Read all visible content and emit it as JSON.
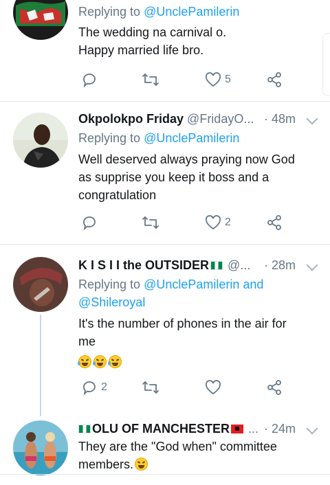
{
  "tweets": [
    {
      "name": "",
      "handle": "",
      "time": "",
      "replying_prefix": "Replying to",
      "replying_line1": "@UnclePamilerin",
      "replying_line2": "",
      "text_lines": [
        "The wedding na carnival o.",
        "Happy married life bro."
      ],
      "reply_count": "",
      "like_count": "5"
    },
    {
      "name": "Okpolokpo Friday",
      "handle": "@FridayO...",
      "time": "· 48m",
      "replying_prefix": "Replying to",
      "replying_line1": "@UnclePamilerin",
      "replying_line2": "",
      "text_lines": [
        "Well deserved always praying now God",
        "as supprise you keep it boss and a",
        "congratulation"
      ],
      "reply_count": "",
      "like_count": "2"
    },
    {
      "name": "K I S I I the OUTSIDER",
      "handle": "@...",
      "time": "· 28m",
      "replying_prefix": "Replying to",
      "replying_line1": "@UnclePamilerin and",
      "replying_line2": "@Shileroyal",
      "text_lines": [
        "It's the number of phones in the air for",
        "me"
      ],
      "reply_count": "2",
      "like_count": ""
    },
    {
      "name": "OLU OF MANCHESTER",
      "handle": "...",
      "time": "· 24m",
      "text_lines": [
        "They are the \"God when\" committee",
        "members."
      ]
    }
  ],
  "icons": {
    "reply": "reply-icon",
    "retweet": "retweet-icon",
    "like": "heart-icon",
    "share": "share-icon",
    "emoji_laugh": "rolling-laughing-emoji",
    "emoji_tears": "tears-of-joy-emoji",
    "flag_nigeria": "nigeria-flag",
    "flag_albania": "albania-flag"
  },
  "colors": {
    "link": "#1da1f2",
    "secondary_text": "#657786",
    "divider": "#e1e8ed"
  }
}
